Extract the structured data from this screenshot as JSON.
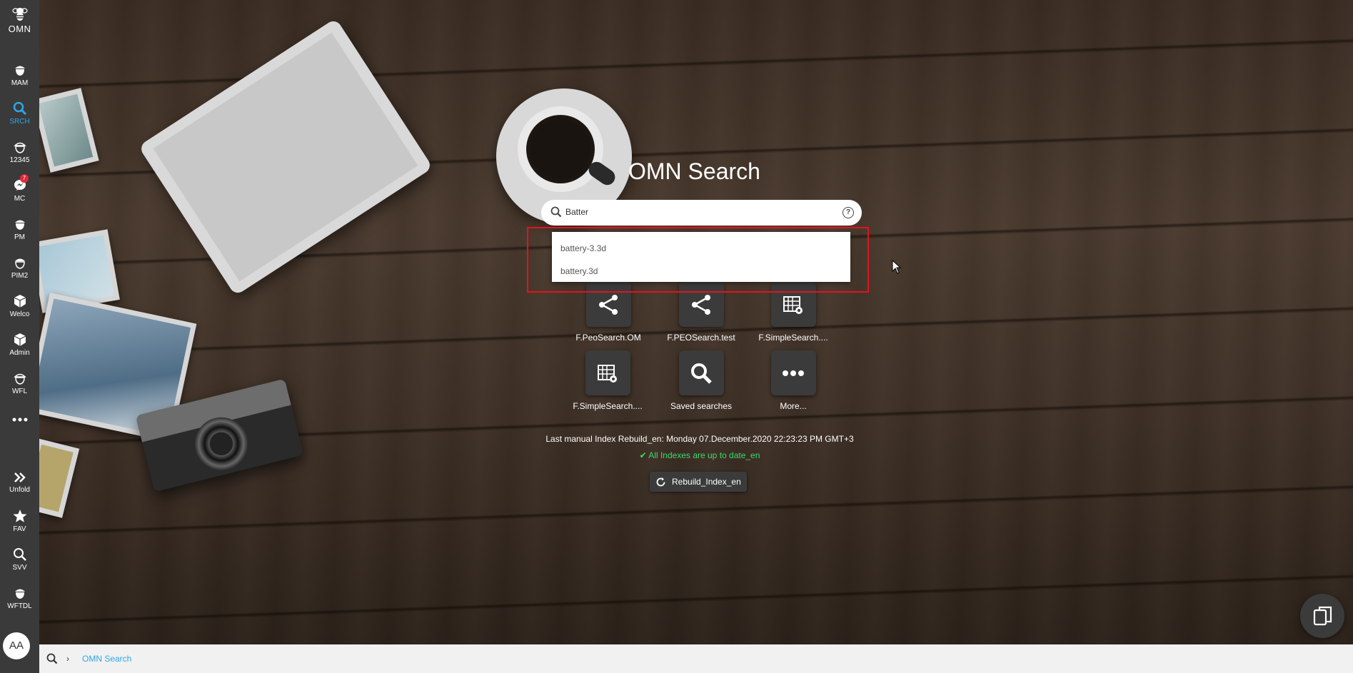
{
  "sidebar": {
    "logo_text": "OMN",
    "items": [
      {
        "label": "MAM",
        "icon": "acorn-icon"
      },
      {
        "label": "SRCH",
        "icon": "search-icon"
      },
      {
        "label": "12345",
        "icon": "acorn-outline-icon"
      },
      {
        "label": "MC",
        "icon": "messenger-icon",
        "badge": "7"
      },
      {
        "label": "PM",
        "icon": "acorn-icon"
      },
      {
        "label": "PIM2",
        "icon": "acorn-icon"
      },
      {
        "label": "Welco",
        "icon": "cube-icon"
      },
      {
        "label": "Admin",
        "icon": "cube-icon"
      },
      {
        "label": "WFL",
        "icon": "acorn-outline-icon"
      },
      {
        "label": "",
        "icon": "more-icon"
      },
      {
        "label": "Unfold",
        "icon": "double-chevron-right-icon"
      },
      {
        "label": "FAV",
        "icon": "star-icon"
      },
      {
        "label": "SVV",
        "icon": "search-icon"
      },
      {
        "label": "WFTDL",
        "icon": "acorn-icon"
      }
    ],
    "avatar": "AA",
    "active_color": "#2ea6e8"
  },
  "main": {
    "title": "OMN Search",
    "search": {
      "value": "Batter",
      "help": "?"
    },
    "suggestions": [
      "battery-3.3d",
      "battery.3d"
    ],
    "tiles": [
      {
        "label": "F.PeoSearch.OM",
        "icon": "share-nodes-icon"
      },
      {
        "label": "F.PEOSearch.test",
        "icon": "share-nodes-icon"
      },
      {
        "label": "F.SimpleSearch....",
        "icon": "calendar-gear-icon"
      },
      {
        "label": "F.SimpleSearch....",
        "icon": "calendar-gear-icon"
      },
      {
        "label": "Saved searches",
        "icon": "search-icon"
      },
      {
        "label": "More...",
        "icon": "more-icon"
      }
    ],
    "last_rebuild": "Last manual Index Rebuild_en: Monday 07.December.2020 22:23:23 PM GMT+3",
    "index_status": "All Indexes are up to date_en",
    "rebuild_button": "Rebuild_Index_en",
    "status_color": "#3fd96b",
    "highlight_color": "#e0141e"
  },
  "footer": {
    "breadcrumb": "OMN Search"
  }
}
